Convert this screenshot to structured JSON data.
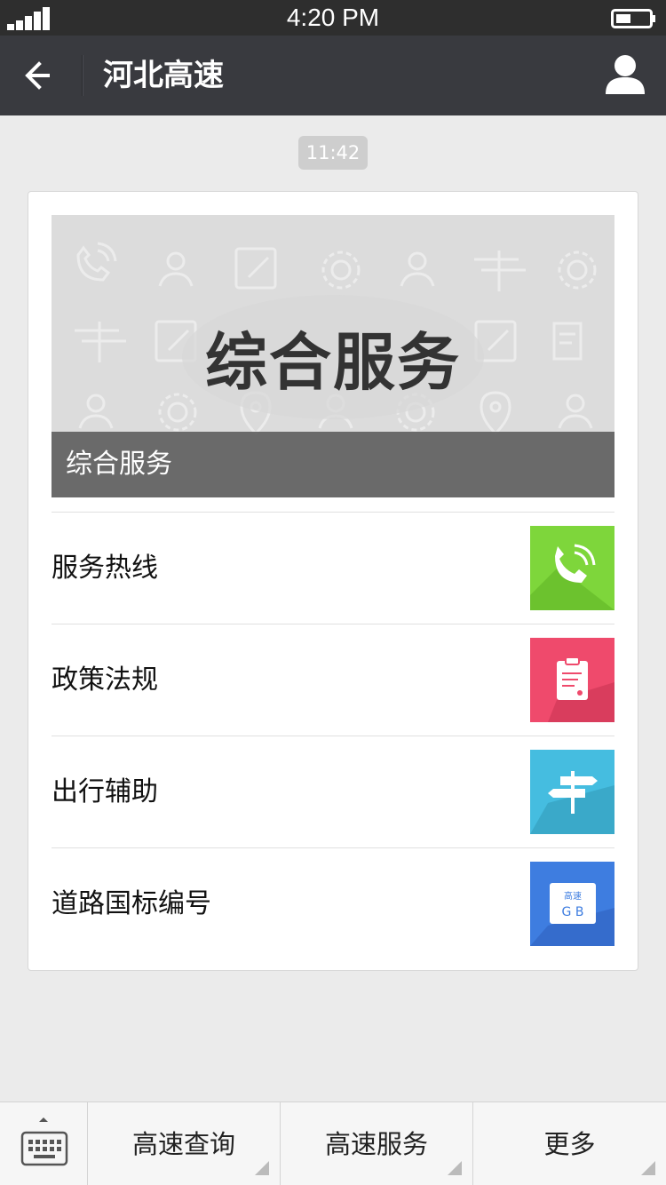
{
  "status_bar": {
    "time": "4:20 PM"
  },
  "header": {
    "title": "河北高速"
  },
  "chat": {
    "timestamp": "11:42"
  },
  "article": {
    "cover_title": "综合服务",
    "cover_caption": "综合服务",
    "items": [
      {
        "label": "服务热线",
        "icon": "phone-icon",
        "color": "#7ed63b"
      },
      {
        "label": "政策法规",
        "icon": "clipboard-icon",
        "color": "#ef4a6c"
      },
      {
        "label": "出行辅助",
        "icon": "signpost-icon",
        "color": "#45bde0"
      },
      {
        "label": "道路国标编号",
        "icon": "gb-code-icon",
        "color": "#3e7de0",
        "thumb_text_top": "高速",
        "thumb_text_bottom": "G B"
      }
    ]
  },
  "bottom_menu": {
    "items": [
      {
        "label": "高速查询"
      },
      {
        "label": "高速服务"
      },
      {
        "label": "更多"
      }
    ]
  },
  "colors": {
    "titlebar": "#393a3f",
    "statusbar": "#2e2e2e",
    "background": "#ebebeb"
  }
}
